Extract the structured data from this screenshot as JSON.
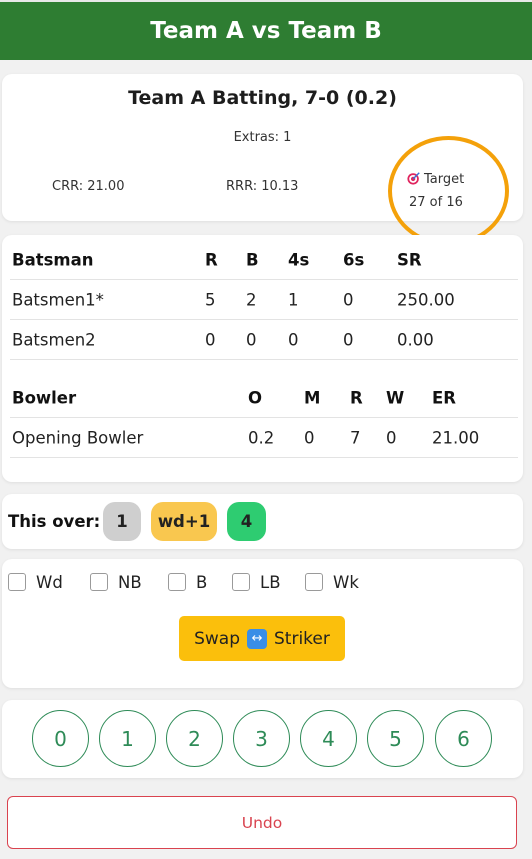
{
  "header": {
    "title": "Team A vs Team B"
  },
  "score": {
    "title": "Team A Batting, 7-0 (0.2)",
    "extras": "Extras: 1",
    "crr": "CRR: 21.00",
    "rrr": "RRR: 10.13",
    "target_label": "Target",
    "target_value": "27 of 16"
  },
  "batting": {
    "headers": [
      "Batsman",
      "R",
      "B",
      "4s",
      "6s",
      "SR"
    ],
    "rows": [
      [
        "Batsmen1*",
        "5",
        "2",
        "1",
        "0",
        "250.00"
      ],
      [
        "Batsmen2",
        "0",
        "0",
        "0",
        "0",
        "0.00"
      ]
    ]
  },
  "bowling": {
    "headers": [
      "Bowler",
      "O",
      "M",
      "R",
      "W",
      "ER"
    ],
    "rows": [
      [
        "Opening Bowler",
        "0.2",
        "0",
        "7",
        "0",
        "21.00"
      ]
    ]
  },
  "this_over": {
    "label": "This over:",
    "balls": [
      {
        "text": "1",
        "color": "#cfcfcf"
      },
      {
        "text": "wd+1",
        "color": "#f9c74f"
      },
      {
        "text": "4",
        "color": "#2ecc71"
      }
    ]
  },
  "extras_checks": [
    "Wd",
    "NB",
    "B",
    "LB",
    "Wk"
  ],
  "swap": {
    "left": "Swap",
    "icon": "↔",
    "right": "Striker"
  },
  "runs": [
    "0",
    "1",
    "2",
    "3",
    "4",
    "5",
    "6"
  ],
  "undo_label": "Undo",
  "colors": {
    "header": "#2e7d32",
    "highlight_ring": "#f4a10a",
    "swap_button": "#fbbf0c",
    "undo": "#d9434f",
    "run_buttons": "#2e8b57"
  }
}
